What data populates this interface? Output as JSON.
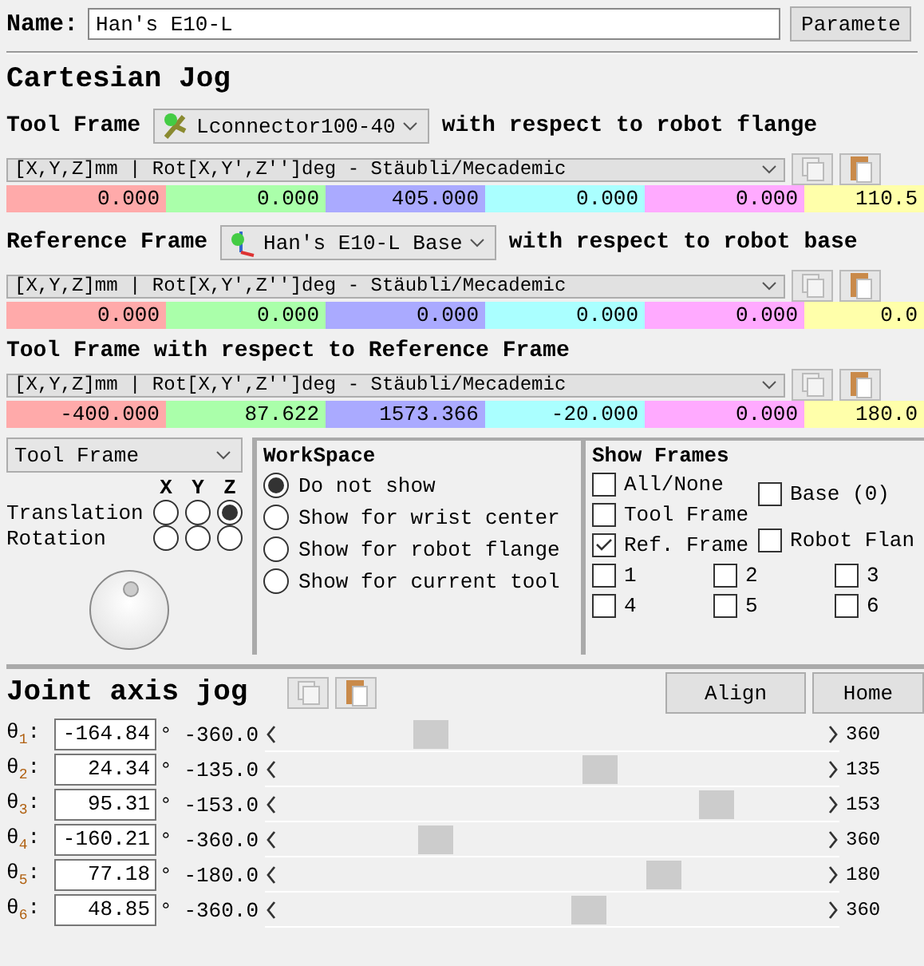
{
  "name_field": {
    "label": "Name:",
    "value": "Han's E10-L"
  },
  "parameters_button": "Paramete",
  "cartesian": {
    "title": "Cartesian Jog",
    "tool_frame": {
      "label": "Tool Frame",
      "dropdown": "Lconnector100-40",
      "suffix": "with respect to robot flange",
      "format": "[X,Y,Z]mm | Rot[X,Y',Z'']deg - Stäubli/Mecademic",
      "values": [
        {
          "value": "0.000",
          "color": "#ffaaaa"
        },
        {
          "value": "0.000",
          "color": "#aaffaa"
        },
        {
          "value": "405.000",
          "color": "#aaaaff"
        },
        {
          "value": "0.000",
          "color": "#aaffff"
        },
        {
          "value": "0.000",
          "color": "#ffaaff"
        },
        {
          "value": "110.5",
          "color": "#ffffaa"
        }
      ]
    },
    "reference_frame": {
      "label": "Reference Frame",
      "dropdown": "Han's E10-L Base",
      "suffix": "with respect to robot base",
      "format": "[X,Y,Z]mm | Rot[X,Y',Z'']deg - Stäubli/Mecademic",
      "values": [
        {
          "value": "0.000",
          "color": "#ffaaaa"
        },
        {
          "value": "0.000",
          "color": "#aaffaa"
        },
        {
          "value": "0.000",
          "color": "#aaaaff"
        },
        {
          "value": "0.000",
          "color": "#aaffff"
        },
        {
          "value": "0.000",
          "color": "#ffaaff"
        },
        {
          "value": "0.0",
          "color": "#ffffaa"
        }
      ]
    },
    "tool_wrt_reference": {
      "label": "Tool Frame with respect to Reference Frame",
      "format": "[X,Y,Z]mm | Rot[X,Y',Z'']deg - Stäubli/Mecademic",
      "values": [
        {
          "value": "-400.000",
          "color": "#ffaaaa"
        },
        {
          "value": "87.622",
          "color": "#aaffaa"
        },
        {
          "value": "1573.366",
          "color": "#aaaaff"
        },
        {
          "value": "-20.000",
          "color": "#aaffff"
        },
        {
          "value": "0.000",
          "color": "#ffaaff"
        },
        {
          "value": "180.0",
          "color": "#ffffaa"
        }
      ]
    }
  },
  "jog_panel": {
    "mode": "Tool Frame",
    "axes": [
      "X",
      "Y",
      "Z"
    ],
    "rows": [
      {
        "label": "Translation",
        "options": [
          {
            "selected": false
          },
          {
            "selected": false
          },
          {
            "selected": true
          }
        ]
      },
      {
        "label": "Rotation",
        "options": [
          {
            "selected": false
          },
          {
            "selected": false
          },
          {
            "selected": false
          }
        ]
      }
    ]
  },
  "workspace": {
    "title": "WorkSpace",
    "options": [
      {
        "label": "Do not show",
        "selected": true
      },
      {
        "label": "Show for wrist center",
        "selected": false
      },
      {
        "label": "Show for robot flange",
        "selected": false
      },
      {
        "label": "Show for current tool",
        "selected": false
      }
    ]
  },
  "show_frames": {
    "title": "Show Frames",
    "frames": [
      {
        "label": "All/None",
        "checked": false
      },
      {
        "label": "Tool Frame",
        "checked": false
      },
      {
        "label": "Ref. Frame",
        "checked": true
      }
    ],
    "robot_frames": [
      {
        "label": "Base (0)",
        "checked": false
      },
      {
        "label": "Robot Flan",
        "checked": false
      }
    ],
    "numbered": [
      {
        "label": "1",
        "checked": false
      },
      {
        "label": "2",
        "checked": false
      },
      {
        "label": "3",
        "checked": false
      },
      {
        "label": "4",
        "checked": false
      },
      {
        "label": "5",
        "checked": false
      },
      {
        "label": "6",
        "checked": false
      }
    ]
  },
  "joint_jog": {
    "title": "Joint axis jog",
    "buttons": [
      "Align",
      "Home"
    ],
    "joints": [
      {
        "label": "θ$_{1}$:",
        "value": "-164.84",
        "unit": "°",
        "min": "-360.0",
        "max": "360",
        "level": 0.27
      },
      {
        "label": "θ$_{2}$:",
        "value": "24.34",
        "unit": "°",
        "min": "-135.0",
        "max": "135",
        "level": 0.59
      },
      {
        "label": "θ$_{3}$:",
        "value": "95.31",
        "unit": "°",
        "min": "-153.0",
        "max": "153",
        "level": 0.81
      },
      {
        "label": "θ$_{4}$:",
        "value": "-160.21",
        "unit": "°",
        "min": "-360.0",
        "max": "360",
        "level": 0.28
      },
      {
        "label": "θ$_{5}$:",
        "value": "77.18",
        "unit": "°",
        "min": "-180.0",
        "max": "180",
        "level": 0.71
      },
      {
        "label": "θ$_{6}$:",
        "value": "48.85",
        "unit": "°",
        "min": "-360.0",
        "max": "360",
        "level": 0.57
      }
    ]
  }
}
